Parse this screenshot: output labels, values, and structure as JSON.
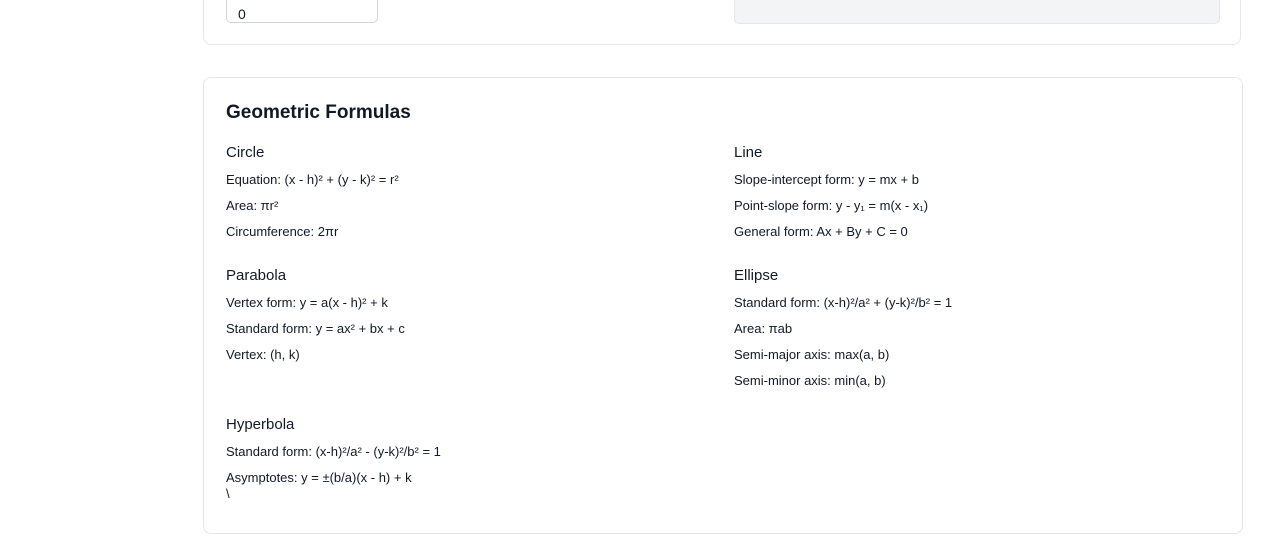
{
  "top": {
    "input_value": "0"
  },
  "formulas_card": {
    "title": "Geometric Formulas",
    "sections": [
      {
        "title": "Circle",
        "items": [
          "Equation: (x - h)² + (y - k)² = r²",
          "Area: πr²",
          "Circumference: 2πr"
        ]
      },
      {
        "title": "Line",
        "items": [
          "Slope-intercept form: y = mx + b",
          "Point-slope form: y - y₁ = m(x - x₁)",
          "General form: Ax + By + C = 0"
        ]
      },
      {
        "title": "Parabola",
        "items": [
          "Vertex form: y = a(x - h)² + k",
          "Standard form: y = ax² + bx + c",
          "Vertex: (h, k)"
        ]
      },
      {
        "title": "Ellipse",
        "items": [
          "Standard form: (x-h)²/a² + (y-k)²/b² = 1",
          "Area: πab",
          "Semi-major axis: max(a, b)",
          "Semi-minor axis: min(a, b)"
        ]
      },
      {
        "title": "Hyperbola",
        "items": [
          "Standard form: (x-h)²/a² - (y-k)²/b² = 1",
          "Asymptotes: y = ±(b/a)(x - h) + k"
        ],
        "trailing_text": "\\"
      }
    ]
  }
}
